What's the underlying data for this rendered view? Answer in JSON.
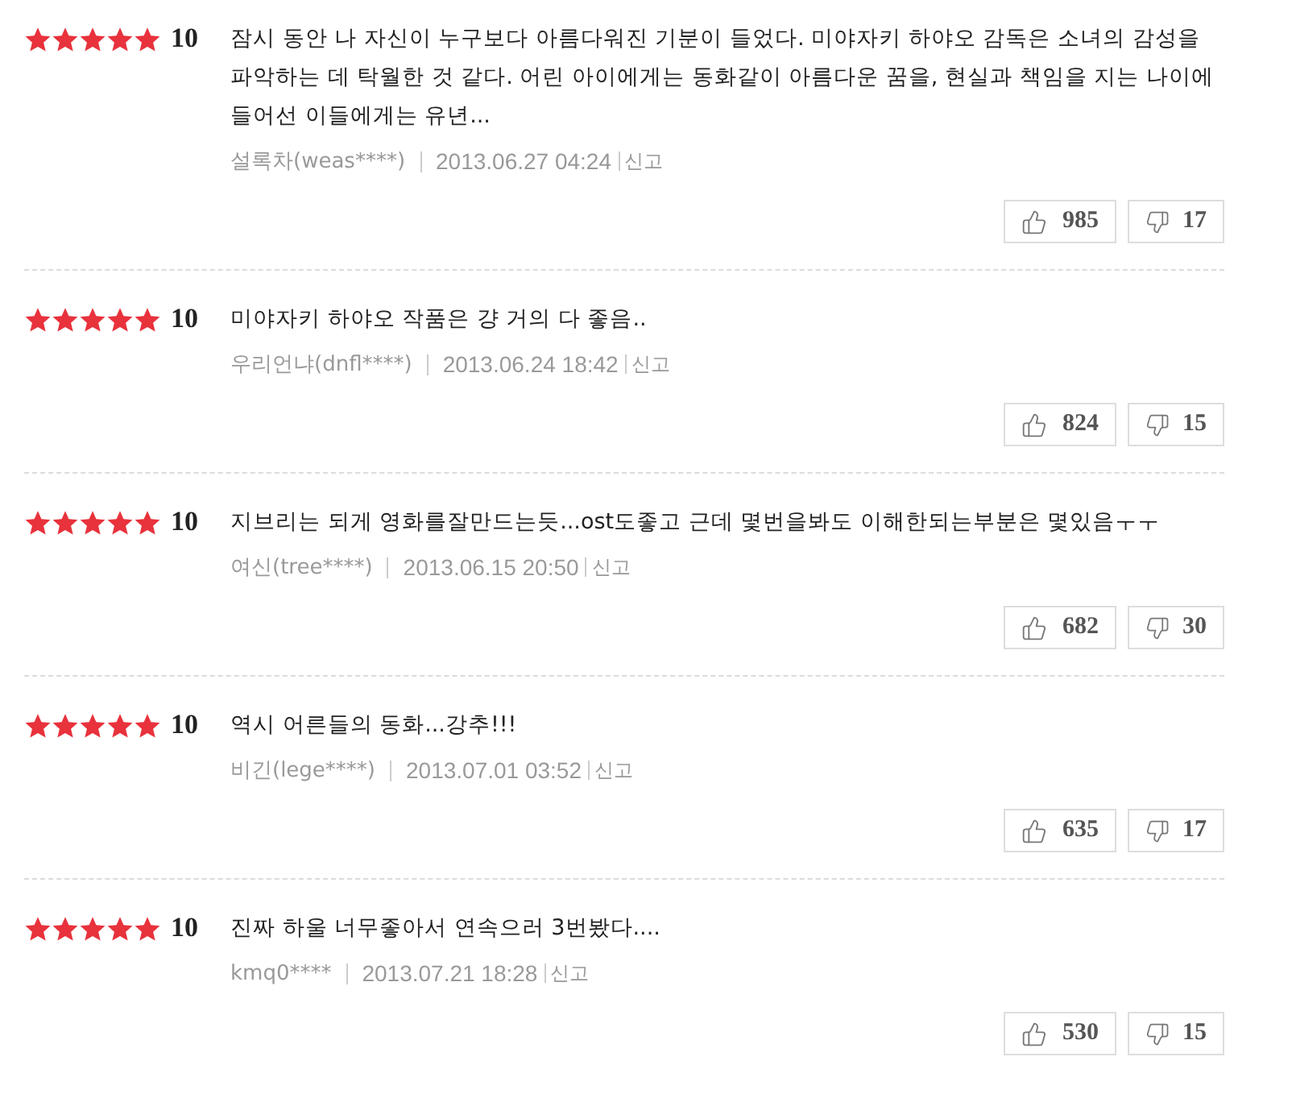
{
  "reviews": [
    {
      "stars": 5,
      "score": "10",
      "text": "잠시 동안 나 자신이 누구보다 아름다워진 기분이 들었다. 미야자키 하야오 감독은 소녀의 감성을 파악하는 데 탁월한 것 같다. 어린 아이에게는 동화같이 아름다운 꿈을, 현실과 책임을 지는 나이에 들어선 이들에게는 유년...",
      "author": "설록차(weas****)",
      "date": "2013.06.27 04:24",
      "report": "신고",
      "likes": "985",
      "dislikes": "17"
    },
    {
      "stars": 5,
      "score": "10",
      "text": "미야자키 하야오 작품은 걍 거의 다 좋음..",
      "author": "우리언냐(dnfl****)",
      "date": "2013.06.24 18:42",
      "report": "신고",
      "likes": "824",
      "dislikes": "15"
    },
    {
      "stars": 5,
      "score": "10",
      "text": "지브리는 되게 영화를잘만드는듯...ost도좋고 근데 몇번을봐도 이해한되는부분은 몇있음ㅜㅜ",
      "author": "여신(tree****)",
      "date": "2013.06.15 20:50",
      "report": "신고",
      "likes": "682",
      "dislikes": "30"
    },
    {
      "stars": 5,
      "score": "10",
      "text": "역시 어른들의 동화...강추!!!",
      "author": "비긴(lege****)",
      "date": "2013.07.01 03:52",
      "report": "신고",
      "likes": "635",
      "dislikes": "17"
    },
    {
      "stars": 5,
      "score": "10",
      "text": "진짜 하울 너무좋아서 연속으러 3번봤다....",
      "author": "kmq0****",
      "date": "2013.07.21 18:28",
      "report": "신고",
      "likes": "530",
      "dislikes": "15"
    }
  ]
}
